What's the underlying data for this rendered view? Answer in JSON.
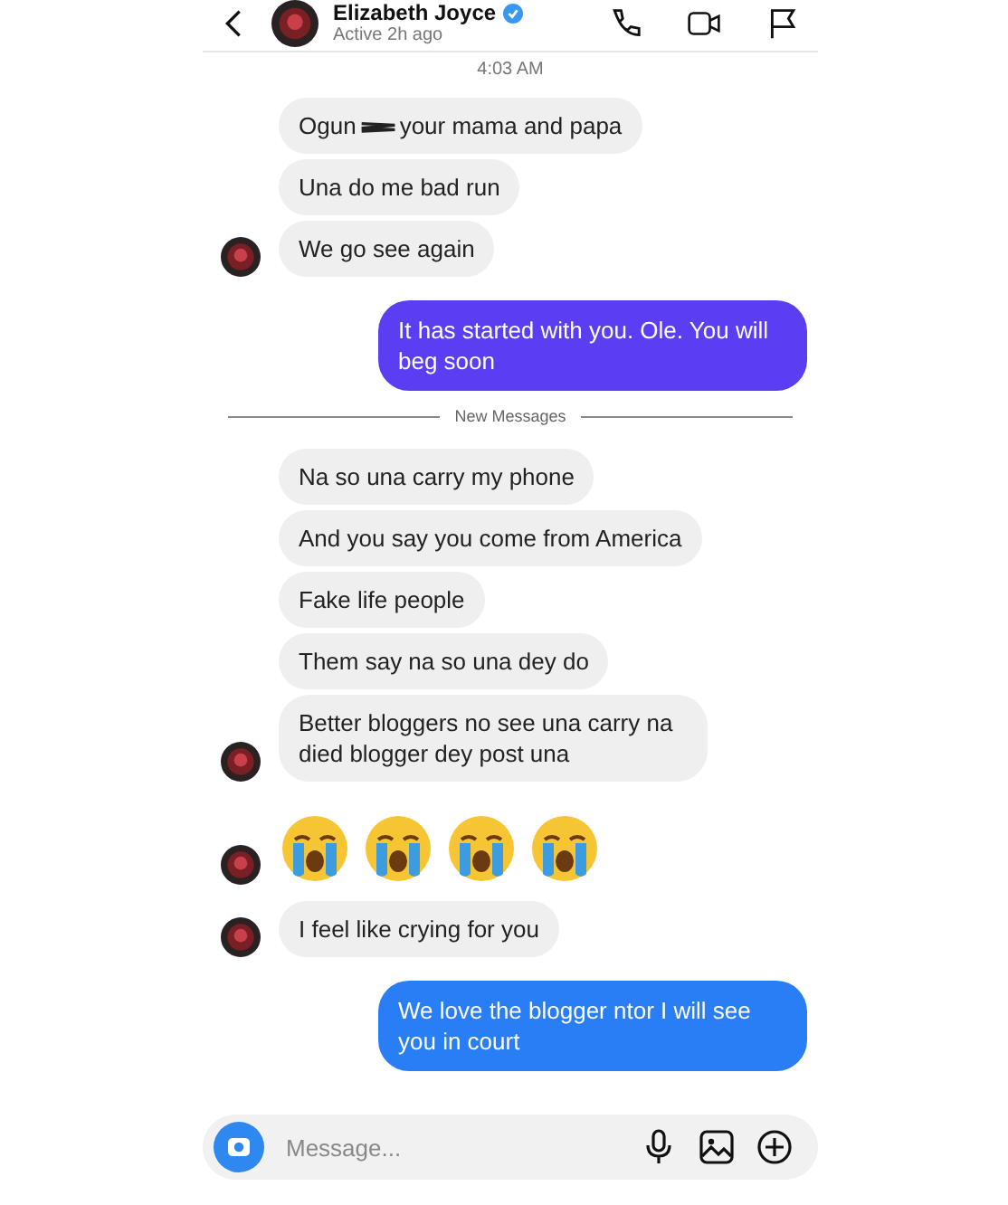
{
  "header": {
    "name": "Elizabeth Joyce",
    "verified": true,
    "status": "Active 2h ago"
  },
  "timestamp": "4:03 AM",
  "messages": [
    {
      "kind": "received-redacted",
      "parts": [
        "Ogun",
        "your mama and papa"
      ],
      "avatar": false
    },
    {
      "kind": "received-text",
      "text": "Una do me bad run",
      "avatar": false
    },
    {
      "kind": "received-text",
      "text": "We go see again",
      "avatar": true
    },
    {
      "kind": "sent-text",
      "text": "It has started with you. Ole. You will beg soon",
      "color": "#5b3ef2"
    },
    {
      "kind": "divider",
      "text": "New Messages"
    },
    {
      "kind": "received-text",
      "text": "Na so una carry my phone",
      "avatar": false
    },
    {
      "kind": "received-text",
      "text": "And you say you come from America",
      "avatar": false
    },
    {
      "kind": "received-text",
      "text": "Fake life people",
      "avatar": false
    },
    {
      "kind": "received-text",
      "text": "Them say na so una dey do",
      "avatar": false
    },
    {
      "kind": "received-text",
      "text": "Better bloggers no see una carry na died blogger dey post una",
      "avatar": true
    },
    {
      "kind": "received-emoji",
      "emojis": [
        {
          "kind": "crying-face"
        },
        {
          "kind": "crying-face"
        },
        {
          "kind": "crying-face"
        },
        {
          "kind": "crying-face"
        }
      ],
      "avatar": true
    },
    {
      "kind": "received-text",
      "text": "I feel like crying for you",
      "avatar": true
    },
    {
      "kind": "sent-text",
      "text": "We love the blogger ntor I will see you in court",
      "color": "#2a7ef5"
    }
  ],
  "composer": {
    "placeholder": "Message..."
  }
}
